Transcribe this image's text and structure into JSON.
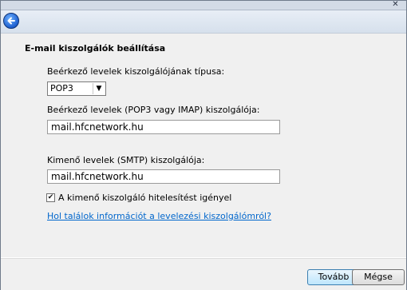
{
  "window": {
    "close_glyph": "✕"
  },
  "heading": "E-mail kiszolgálók beállítása",
  "incoming_type": {
    "label": "Beérkező levelek kiszolgálójának típusa:",
    "selected": "POP3"
  },
  "incoming_server": {
    "label": "Beérkező levelek (POP3 vagy IMAP) kiszolgálója:",
    "value": "mail.hfcnetwork.hu"
  },
  "outgoing_server": {
    "label": "Kimenő levelek (SMTP) kiszolgálója:",
    "value": "mail.hfcnetwork.hu"
  },
  "auth_checkbox": {
    "label": "A kimenő kiszolgáló hitelesítést igényel",
    "checked": true
  },
  "help_link": "Hol találok információt a levelezési kiszolgálómról?",
  "buttons": {
    "next": "Tovább",
    "cancel": "Mégse"
  }
}
